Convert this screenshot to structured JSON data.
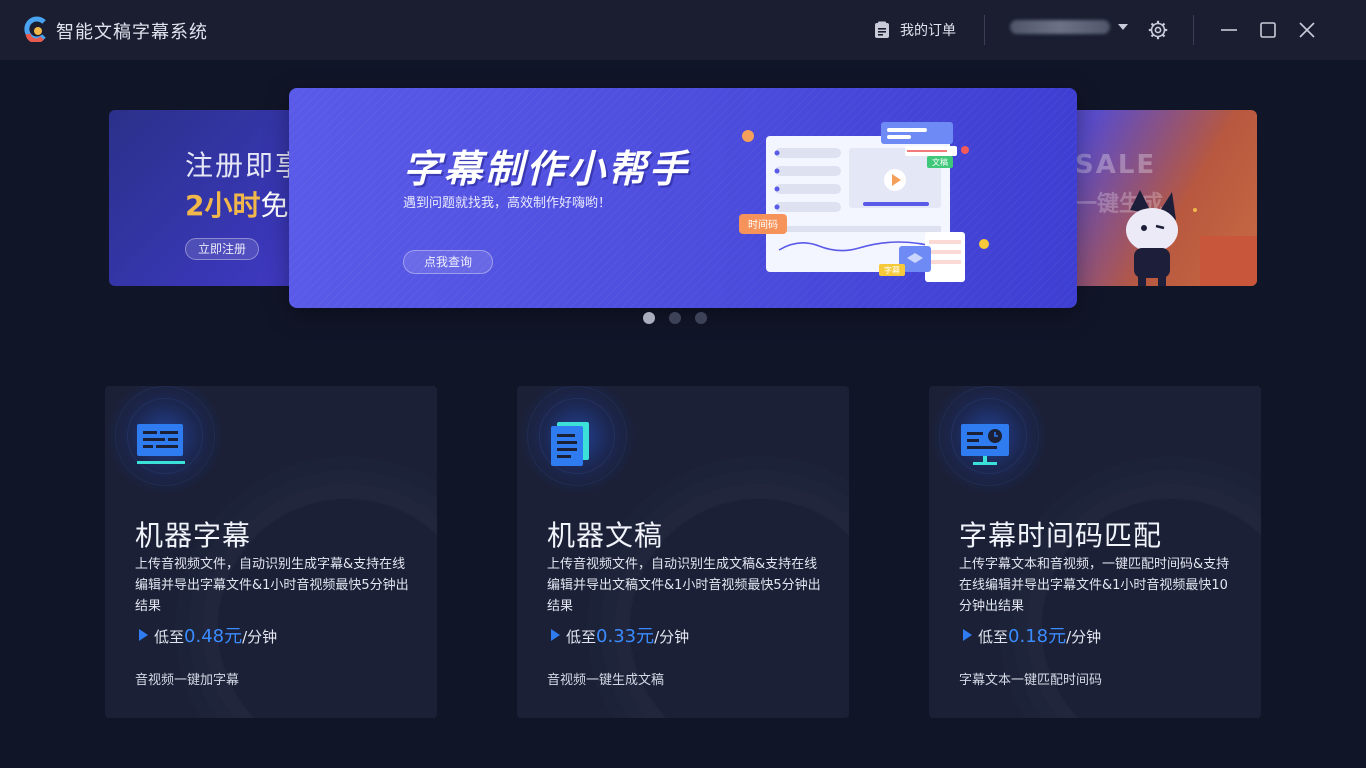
{
  "app": {
    "title": "智能文稿字幕系统",
    "brand_colors": [
      "#2f7bf0",
      "#f2b74a",
      "#e85a4f"
    ]
  },
  "header": {
    "orders_label": "我的订单",
    "icons": [
      "clipboard-icon",
      "chevron-down-icon",
      "gear-icon",
      "minimize-icon",
      "maximize-icon",
      "close-icon"
    ]
  },
  "banners": {
    "left": {
      "line1": "注册即享",
      "line2_highlight": "2小时",
      "line2_rest": "免",
      "button": "立即注册"
    },
    "main": {
      "title": "字幕制作小帮手",
      "subtitle": "遇到问题就找我，高效制作好嗨哟！",
      "button": "点我查询",
      "tags": {
        "timecode": "时间码",
        "doc": "文稿",
        "subtitle": "字幕"
      }
    },
    "right": {
      "text1": "SALE",
      "text2": "一键生成"
    },
    "dots": 3,
    "active_dot": 0
  },
  "cards": [
    {
      "icon": "subtitle-lines-icon",
      "title": "机器字幕",
      "desc": "上传音视频文件，自动识别生成字幕&支持在线编辑并导出字幕文件&1小时音视频最快5分钟出结果",
      "price_prefix": "低至",
      "price_value": "0.48元",
      "price_suffix": "/分钟",
      "action": "音视频一键加字幕"
    },
    {
      "icon": "document-icon",
      "title": "机器文稿",
      "desc": "上传音视频文件，自动识别生成文稿&支持在线编辑并导出文稿文件&1小时音视频最快5分钟出结果",
      "price_prefix": "低至",
      "price_value": "0.33元",
      "price_suffix": "/分钟",
      "action": "音视频一键生成文稿"
    },
    {
      "icon": "monitor-clock-icon",
      "title": "字幕时间码匹配",
      "desc": "上传字幕文本和音视频，一键匹配时间码&支持在线编辑并导出字幕文件&1小时音视频最快10分钟出结果",
      "price_prefix": "低至",
      "price_value": "0.18元",
      "price_suffix": "/分钟",
      "action": "字幕文本一键匹配时间码"
    }
  ]
}
